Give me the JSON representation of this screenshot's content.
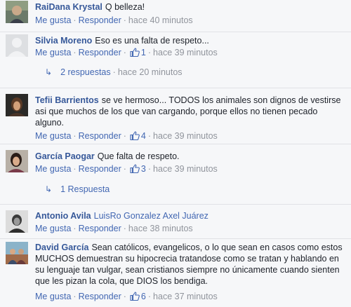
{
  "common": {
    "like": "Me gusta",
    "reply": "Responder",
    "sep": "·"
  },
  "comments": [
    {
      "author": "RaiDana Krystal",
      "text": "Q belleza!",
      "likes": "",
      "time": "hace 40 minutos"
    },
    {
      "author": "Silvia Moreno",
      "text": "Eso es una falta de respeto...",
      "likes": "1",
      "time": "hace 39 minutos",
      "replies_label": "2 respuestas",
      "replies_time": "hace 20 minutos"
    },
    {
      "author": "Tefii Barrientos",
      "text": "se ve hermoso... TODOS los animales son dignos de vestirse asi que muchos de los que van cargando, porque ellos no tienen pecado alguno.",
      "likes": "4",
      "time": "hace 39 minutos"
    },
    {
      "author": "García Paogar",
      "text": "Que falta de respeto.",
      "likes": "3",
      "time": "hace 39 minutos",
      "replies_label": "1 Respuesta"
    },
    {
      "author": "Antonio Avila",
      "text": "LuisRo Gonzalez Axel Juárez",
      "likes": "",
      "time": "hace 38 minutos"
    },
    {
      "author": "David García",
      "text": "Sean católicos, evangelicos, o lo que sean en casos como estos MUCHOS demuestran su hipocrecia tratandose como se tratan y hablando en su lenguaje tan vulgar, sean cristianos siempre no únicamente cuando sienten que les pizan la cola, que DIOS los bendiga.",
      "likes": "6",
      "time": "hace 37 minutos"
    }
  ],
  "colors": {
    "author": "#365899",
    "link": "#4267b2",
    "meta": "#90949c",
    "background": "#f6f7f9"
  }
}
